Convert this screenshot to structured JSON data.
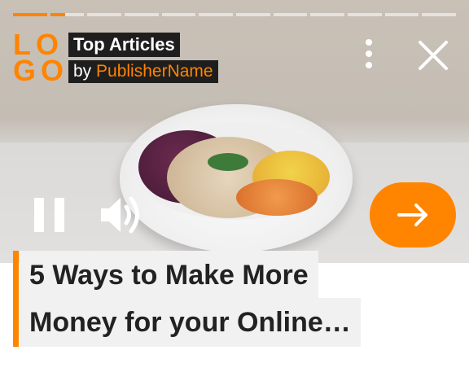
{
  "story": {
    "progress": {
      "segment_count": 12,
      "current_segment_fill": 0.45
    },
    "logo": {
      "line1": "LO",
      "line2": "GO"
    },
    "header": {
      "title": "Top Articles",
      "by_prefix": "by",
      "publisher": "PublisherName"
    },
    "headline": {
      "line1": "5 Ways to Make More",
      "line2": "Money for your Online…"
    },
    "icons": {
      "more": "more-vertical-icon",
      "close": "close-icon",
      "pause": "pause-icon",
      "sound": "volume-icon",
      "next": "arrow-right-icon"
    },
    "colors": {
      "accent": "#ff8400",
      "label_bg": "#1e1e1e",
      "headline_bg": "#f1f1f1",
      "headline_text": "#222222"
    }
  }
}
